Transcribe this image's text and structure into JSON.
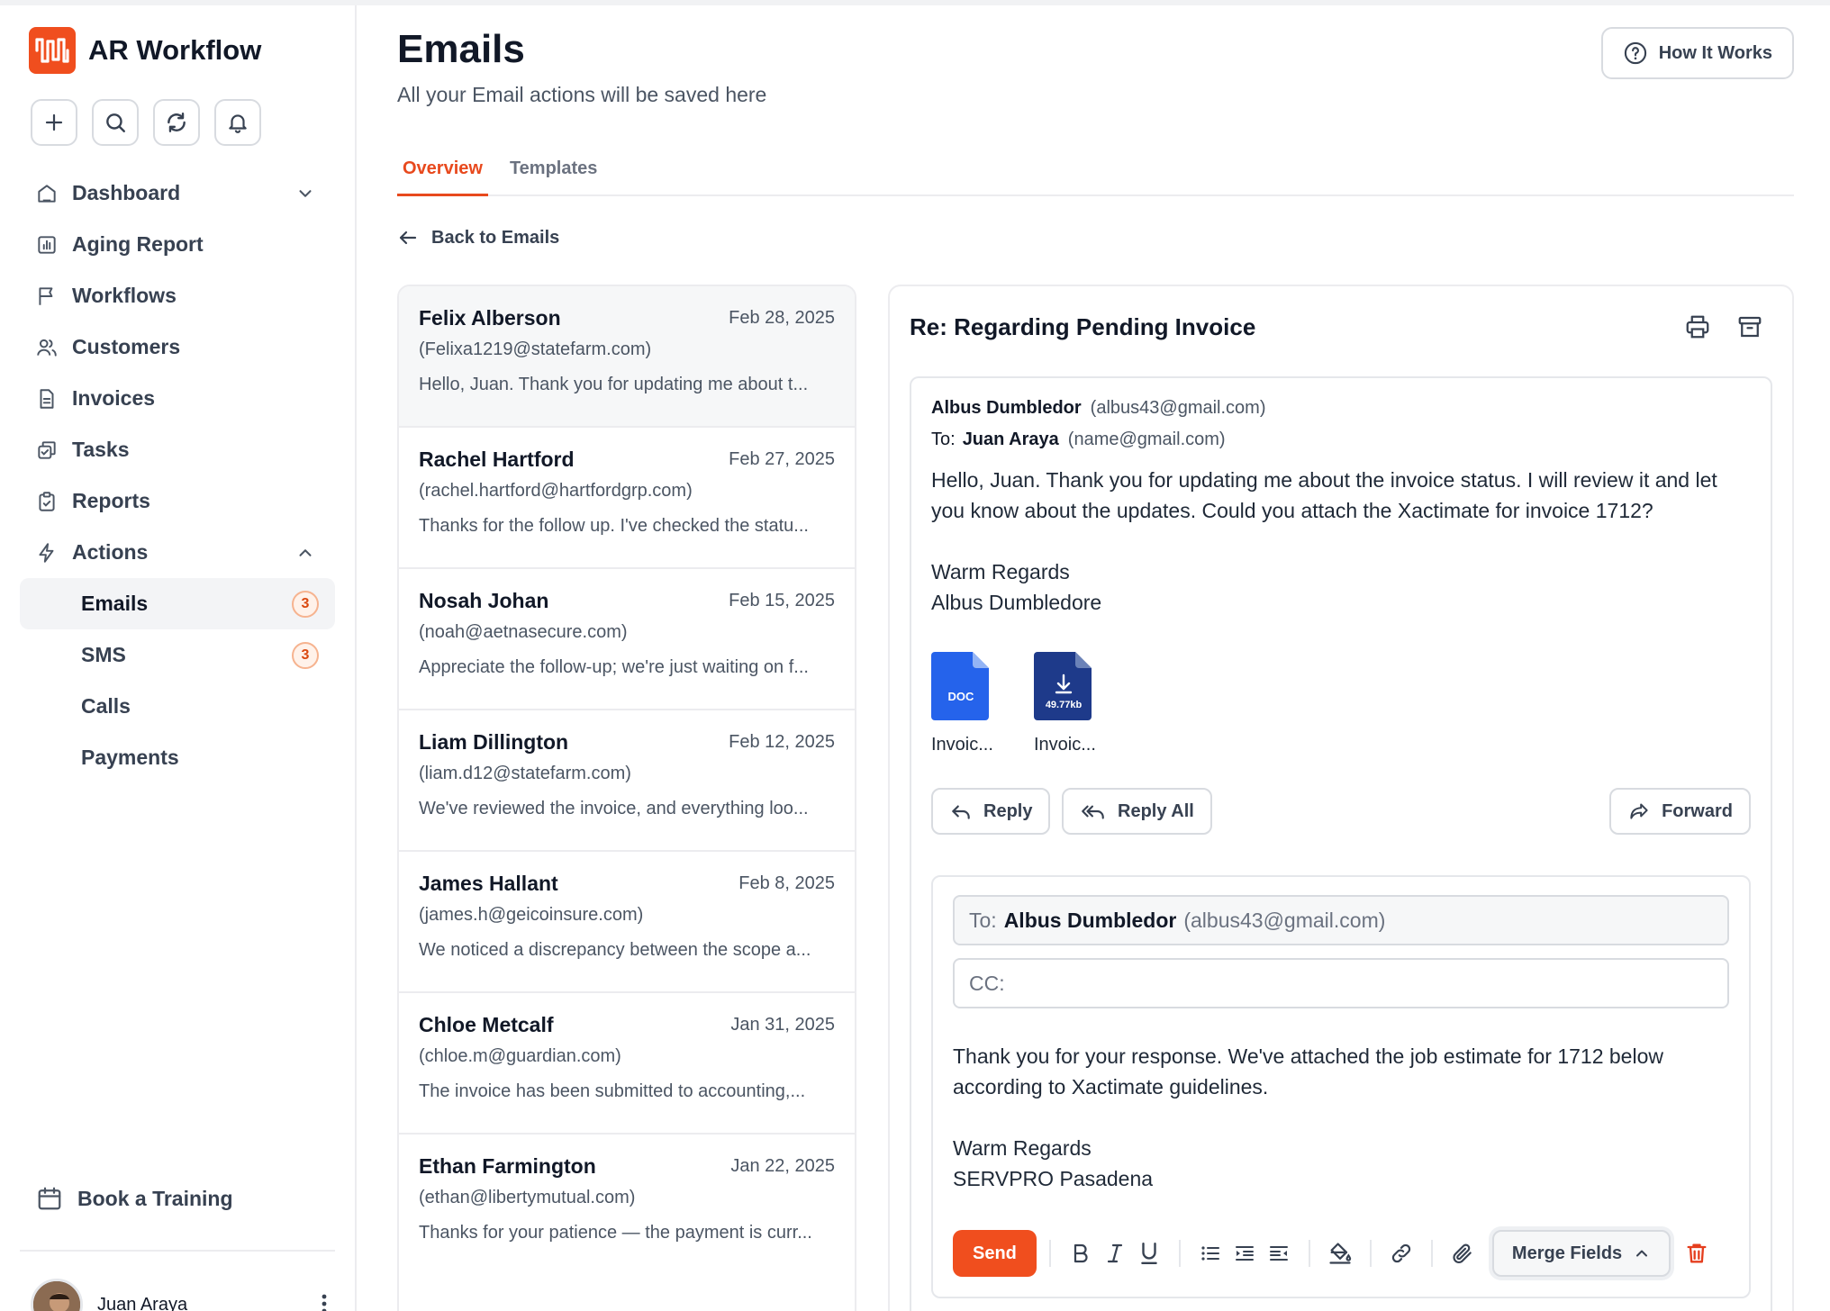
{
  "colors": {
    "accent": "#f04e1e",
    "doc_blue": "#2563eb",
    "download_navy": "#1e3a8a"
  },
  "brand": {
    "name": "AR Workflow"
  },
  "quick_actions": [
    "plus-icon",
    "search-icon",
    "refresh-icon",
    "bell-icon"
  ],
  "nav": {
    "dashboard": "Dashboard",
    "aging": "Aging Report",
    "workflows": "Workflows",
    "customers": "Customers",
    "invoices": "Invoices",
    "tasks": "Tasks",
    "reports": "Reports",
    "actions": "Actions",
    "emails": "Emails",
    "emails_badge": "3",
    "sms": "SMS",
    "sms_badge": "3",
    "calls": "Calls",
    "payments": "Payments"
  },
  "book": "Book a Training",
  "user": {
    "name": "Juan Araya"
  },
  "header": {
    "title": "Emails",
    "subtitle": "All your Email actions will be saved here",
    "how": "How It Works"
  },
  "tabs": {
    "overview": "Overview",
    "templates": "Templates"
  },
  "back": "Back to Emails",
  "emails": [
    {
      "name": "Felix Alberson",
      "date": "Feb 28, 2025",
      "email": "(Felixa1219@statefarm.com)",
      "snippet": "Hello, Juan. Thank you for updating me about t..."
    },
    {
      "name": "Rachel Hartford",
      "date": "Feb 27, 2025",
      "email": "(rachel.hartford@hartfordgrp.com)",
      "snippet": "Thanks for the follow up. I've checked the statu..."
    },
    {
      "name": "Nosah Johan",
      "date": "Feb 15, 2025",
      "email": "(noah@aetnasecure.com)",
      "snippet": "Appreciate the follow-up; we're just waiting on f..."
    },
    {
      "name": "Liam Dillington",
      "date": "Feb 12, 2025",
      "email": "(liam.d12@statefarm.com)",
      "snippet": "We've reviewed the invoice, and everything loo..."
    },
    {
      "name": "James Hallant",
      "date": "Feb 8, 2025",
      "email": "(james.h@geicoinsure.com)",
      "snippet": "We noticed a discrepancy between the scope a..."
    },
    {
      "name": "Chloe Metcalf",
      "date": "Jan 31, 2025",
      "email": "(chloe.m@guardian.com)",
      "snippet": "The invoice has been submitted to accounting,..."
    },
    {
      "name": "Ethan Farmington",
      "date": "Jan 22, 2025",
      "email": "(ethan@libertymutual.com)",
      "snippet": "Thanks for your patience — the payment is curr..."
    }
  ],
  "detail": {
    "subject": "Re: Regarding Pending Invoice",
    "from_name": "Albus Dumbledor",
    "from_email": "(albus43@gmail.com)",
    "to_label": "To:",
    "to_name": "Juan Araya",
    "to_email": "(name@gmail.com)",
    "body": "Hello, Juan. Thank you for updating me about the invoice status. I will review it and let you know about the updates. Could you attach the Xactimate for invoice 1712?",
    "sig1": "Warm Regards",
    "sig2": "Albus Dumbledore",
    "att1": {
      "type": "DOC",
      "name": "Invoic..."
    },
    "att2": {
      "size": "49.77kb",
      "name": "Invoic..."
    },
    "reply": "Reply",
    "reply_all": "Reply All",
    "forward": "Forward"
  },
  "compose": {
    "to_label": "To:",
    "to_name": "Albus Dumbledor",
    "to_email": "(albus43@gmail.com)",
    "cc_label": "CC:",
    "body": "Thank you for your response. We've attached the job estimate for 1712 below according to Xactimate guidelines.",
    "sig1": "Warm Regards",
    "sig2": "SERVPRO Pasadena",
    "send": "Send",
    "merge": "Merge Fields"
  }
}
